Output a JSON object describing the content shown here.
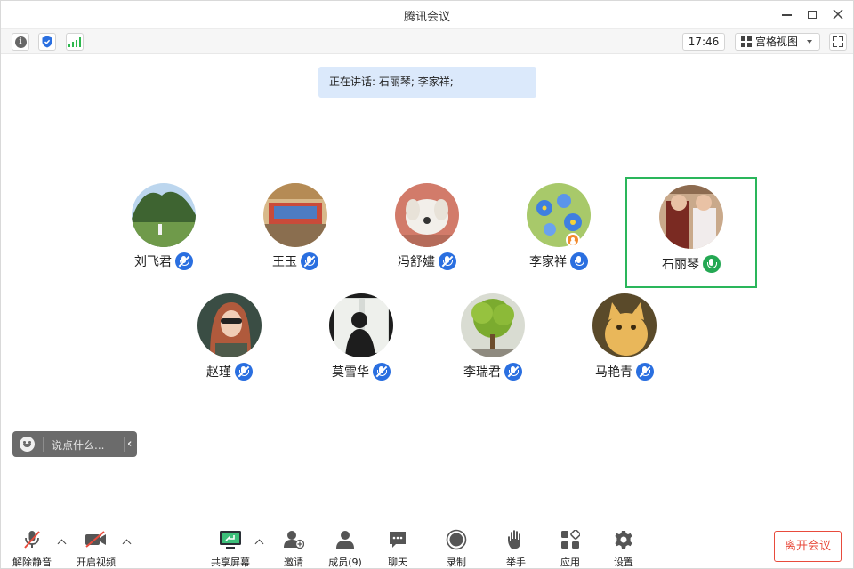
{
  "window": {
    "title": "腾讯会议"
  },
  "infobar": {
    "icons": [
      "info-icon",
      "shield-icon",
      "signal-icon"
    ],
    "time": "17:46",
    "view_mode": "宫格视图"
  },
  "speaking": {
    "text": "正在讲话: 石丽琴; 李家祥;"
  },
  "participants": [
    {
      "name": "刘飞君",
      "mic": "muted",
      "avatar": "mountain-avatar"
    },
    {
      "name": "王玉",
      "mic": "muted",
      "avatar": "classroom-avatar"
    },
    {
      "name": "冯舒嫿",
      "mic": "muted",
      "avatar": "dog-avatar"
    },
    {
      "name": "李家祥",
      "mic": "on",
      "avatar": "flower-avatar",
      "host": true
    },
    {
      "name": "石丽琴",
      "mic": "speaking",
      "avatar": "kids-avatar",
      "active": true
    },
    {
      "name": "赵瑾",
      "mic": "muted",
      "avatar": "woman-avatar"
    },
    {
      "name": "莫雪华",
      "mic": "muted",
      "avatar": "silhouette-avatar"
    },
    {
      "name": "李瑞君",
      "mic": "muted",
      "avatar": "tree-avatar"
    },
    {
      "name": "马艳青",
      "mic": "muted",
      "avatar": "cat-avatar"
    }
  ],
  "chat": {
    "placeholder": "说点什么..."
  },
  "toolbar": {
    "unmute": "解除静音",
    "video": "开启视频",
    "share": "共享屏幕",
    "invite": "邀请",
    "members": "成员(9)",
    "chat": "聊天",
    "record": "录制",
    "raise_hand": "举手",
    "apps": "应用",
    "settings": "设置",
    "leave": "离开会议"
  },
  "colors": {
    "accent_blue": "#2a6fe0",
    "speaking_green": "#2ab65b",
    "leave_red": "#e84b3c"
  }
}
